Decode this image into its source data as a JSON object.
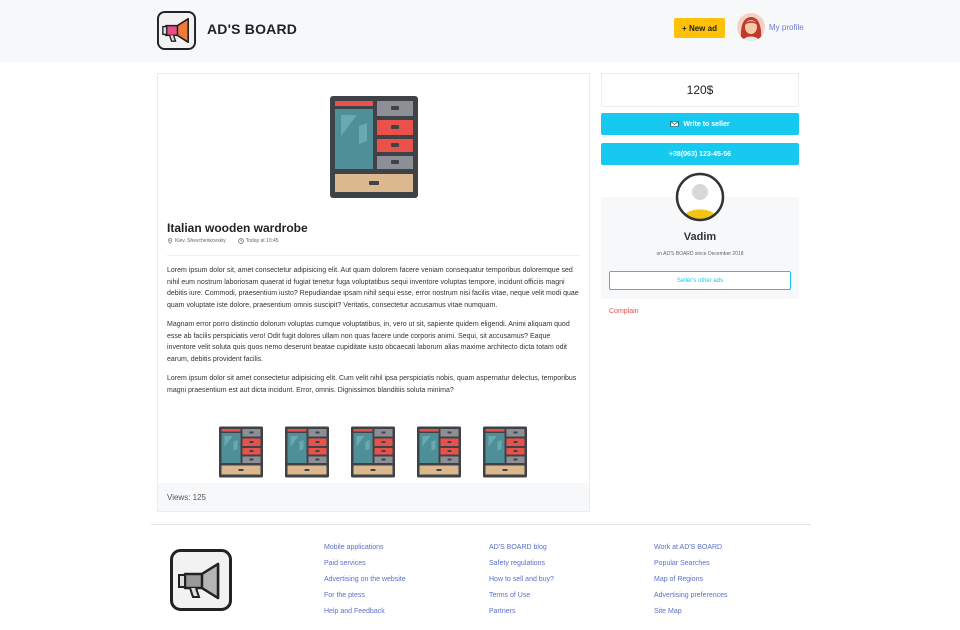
{
  "header": {
    "brand": "AD'S BOARD",
    "new_ad_label": "+ New ad",
    "profile_label": "My profile"
  },
  "ad": {
    "title": "Italian wooden wardrobe",
    "location": "Kiev, Shevchenkovskiy",
    "posted": "Today at 10:45",
    "paragraphs": [
      "Lorem ipsum dolor sit, amet consectetur adipisicing elit. Aut quam dolorem facere veniam consequatur temporibus doloremque sed nihil eum nostrum laboriosam quaerat id fugiat tenetur fuga voluptatibus sequi inventore voluptas tempore, incidunt officiis magni debitis iure. Commodi, praesentium iusto? Repudiandae ipsam nihil sequi esse, error nostrum nisi facilis vitae, neque velit modi quae quam voluptate iste dolore, praesentium omnis suscipit? Veritatis, consectetur accusamus vitae numquam.",
      "Magnam error porro distinctio dolorum voluptas cumque voluptatibus, in, vero ut sit, sapiente quidem eligendi. Animi aliquam quod esse ab facilis perspiciatis vero! Odit fugit dolores ullam non quas facere unde corporis animi. Sequi, sit accusamus? Eaque inventore velit soluta quis quos nemo deserunt beatae cupiditate iusto obcaecati laborum alias maxime architecto dicta totam odit earum, debitis provident facilis.",
      "Lorem ipsum dolor sit amet consectetur adipisicing elit. Cum velit nihil ipsa perspiciatis nobis, quam aspernatur delectus, temporibus magni praesentium est aut dicta incidunt. Error, omnis. Dignissimos blanditiis soluta minima?"
    ],
    "thumbnail_count": 5,
    "views": "Views: 125"
  },
  "sidebar": {
    "price": "120$",
    "write_label": "Write to seller",
    "phone": "+38(063) 123-45-56",
    "seller_name": "Vadim",
    "seller_since": "on AD'S BOARD since December 2018",
    "other_ads_label": "Seller's other ads",
    "complain_label": "Complain"
  },
  "footer": {
    "col1": [
      "Mobile applications",
      "Paid services",
      "Advertising on the website",
      "For the ptess",
      "Help and Feedback"
    ],
    "col2": [
      "AD'S BOARD blog",
      "Safety regulations",
      "How to sell and buy?",
      "Terms of Use",
      "Partners"
    ],
    "col3": [
      "Work at AD'S BOARD",
      "Popular Searches",
      "Map of Regions",
      "Advertising preferences",
      "Site Map"
    ]
  },
  "colors": {
    "accent_cyan": "#17c9ef",
    "accent_yellow": "#ffc107",
    "link_blue": "#5b6fcf",
    "complain_red": "#e05252"
  },
  "icons": [
    "megaphone-logo-icon",
    "location-pin-icon",
    "clock-icon",
    "envelope-icon",
    "user-avatar-icon",
    "wardrobe-image"
  ]
}
